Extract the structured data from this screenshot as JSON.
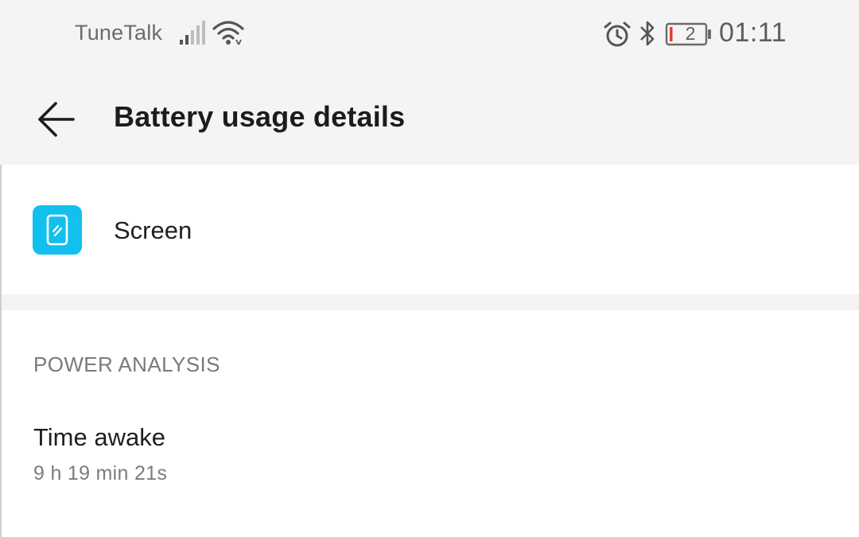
{
  "status_bar": {
    "carrier": "TuneTalk",
    "battery_level": "2",
    "time": "01:11",
    "icons": [
      "signal-icon",
      "wifi-icon",
      "alarm-icon",
      "bluetooth-icon",
      "battery-icon"
    ]
  },
  "app_bar": {
    "title": "Battery usage details",
    "back_icon": "arrow-left-icon"
  },
  "app_item": {
    "name": "Screen",
    "icon": "screen-icon",
    "icon_color": "#12c0ee"
  },
  "power_analysis": {
    "header": "POWER ANALYSIS",
    "rows": [
      {
        "title": "Time awake",
        "value": "9 h 19 min 21s"
      }
    ]
  },
  "colors": {
    "background": "#f4f4f4",
    "card": "#ffffff",
    "battery_low": "#e53935"
  }
}
